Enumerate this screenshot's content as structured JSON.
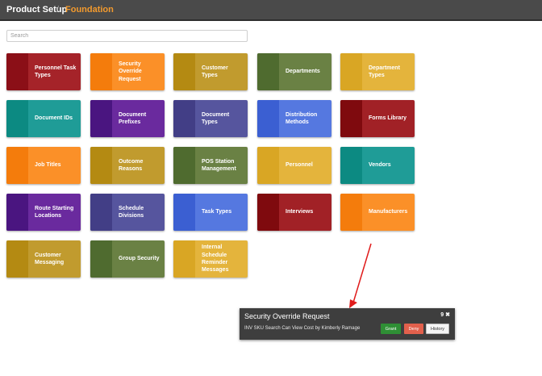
{
  "header": {
    "root": "Product Setup",
    "separator": "/",
    "current": "Foundation"
  },
  "search": {
    "placeholder": "Search"
  },
  "tiles": [
    {
      "label": "Personnel Task Types",
      "strip": "#8b0f17",
      "body": "#a52329"
    },
    {
      "label": "Security Override Request",
      "strip": "#f47c0c",
      "body": "#fb9028"
    },
    {
      "label": "Customer Types",
      "strip": "#b48a12",
      "body": "#c19b2e"
    },
    {
      "label": "Departments",
      "strip": "#4f6b2f",
      "body": "#6a8144"
    },
    {
      "label": "Department Types",
      "strip": "#d9a624",
      "body": "#e4b43c"
    },
    {
      "label": "Document IDs",
      "strip": "#0c8a82",
      "body": "#1f9c97"
    },
    {
      "label": "Document Prefixes",
      "strip": "#4a1580",
      "body": "#6a2a9e"
    },
    {
      "label": "Document Types",
      "strip": "#423e86",
      "body": "#56559e"
    },
    {
      "label": "Distribution Methods",
      "strip": "#3b5fd2",
      "body": "#5578e0"
    },
    {
      "label": "Forms Library",
      "strip": "#7f0a0e",
      "body": "#a12126"
    },
    {
      "label": "Job Titles",
      "strip": "#f47c0c",
      "body": "#fb9028"
    },
    {
      "label": "Outcome Reasons",
      "strip": "#b48a12",
      "body": "#c19b2e"
    },
    {
      "label": "POS Station Management",
      "strip": "#4f6b2f",
      "body": "#6a8144"
    },
    {
      "label": "Personnel",
      "strip": "#d9a624",
      "body": "#e4b43c"
    },
    {
      "label": "Vendors",
      "strip": "#0c8a82",
      "body": "#1f9c97"
    },
    {
      "label": "Route Starting Locations",
      "strip": "#4a1580",
      "body": "#6a2a9e"
    },
    {
      "label": "Schedule Divisions",
      "strip": "#423e86",
      "body": "#56559e"
    },
    {
      "label": "Task Types",
      "strip": "#3b5fd2",
      "body": "#5578e0"
    },
    {
      "label": "Interviews",
      "strip": "#7f0a0e",
      "body": "#a12126"
    },
    {
      "label": "Manufacturers",
      "strip": "#f47c0c",
      "body": "#fb9028"
    },
    {
      "label": "Customer Messaging",
      "strip": "#b48a12",
      "body": "#c19b2e"
    },
    {
      "label": "Group Security",
      "strip": "#4f6b2f",
      "body": "#6a8144"
    },
    {
      "label": "Internal Schedule Reminder Messages",
      "strip": "#d9a624",
      "body": "#e4b43c"
    }
  ],
  "popup": {
    "title": "Security Override Request",
    "count": "9",
    "close_icon": "✖",
    "message": "INV SKU Search Can View Cost by Kimberly Ramage",
    "grant_label": "Grant",
    "deny_label": "Deny",
    "history_label": "History"
  }
}
